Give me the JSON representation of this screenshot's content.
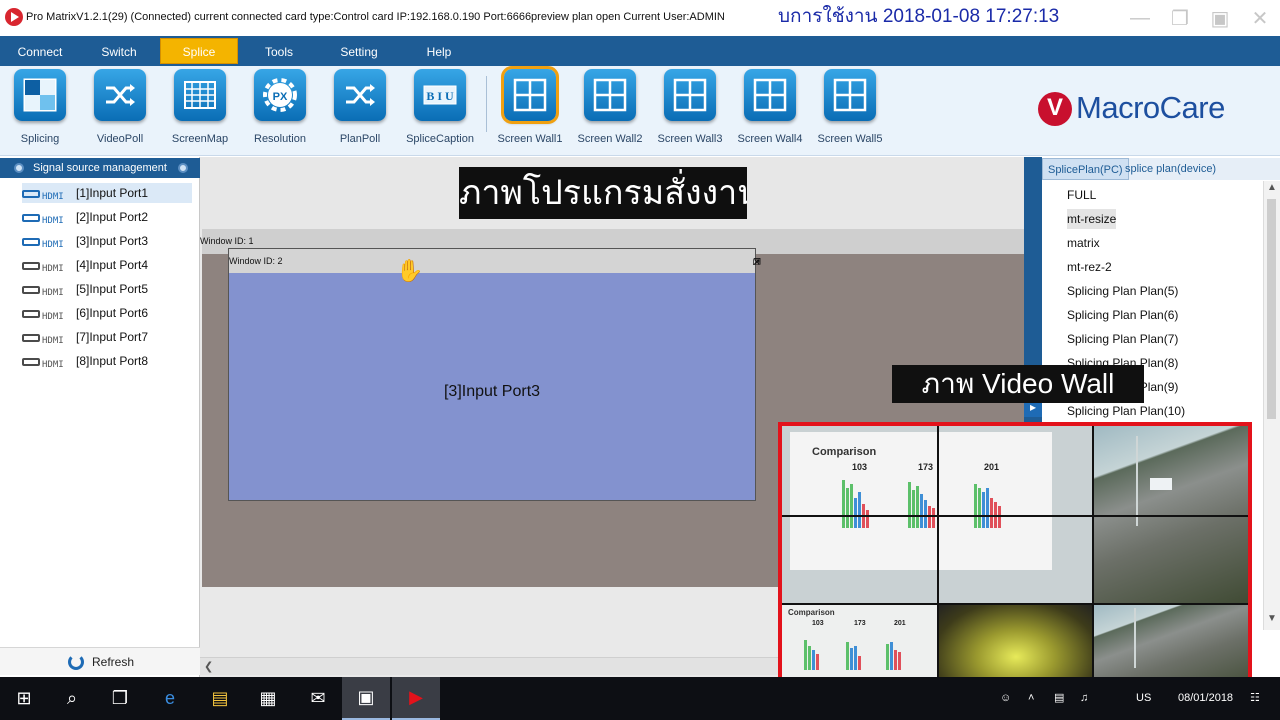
{
  "titlebar": {
    "title": "Pro MatrixV1.2.1(29) (Connected)  current connected card type:Control card    IP:192.168.0.190   Port:6666preview plan open   Current User:ADMIN",
    "overlay_datetime": "บการใช้งาน   2018-01-08 17:27:13"
  },
  "menu": {
    "items": [
      "Connect",
      "Switch",
      "Splice",
      "Tools",
      "Setting",
      "Help"
    ],
    "active": "Splice"
  },
  "toolbar": {
    "tools": [
      {
        "label": "Splicing",
        "icon": "splicing-icon"
      },
      {
        "label": "VideoPoll",
        "icon": "shuffle-icon"
      },
      {
        "label": "ScreenMap",
        "icon": "grid-icon"
      },
      {
        "label": "Resolution",
        "icon": "gear-px-icon"
      },
      {
        "label": "PlanPoll",
        "icon": "shuffle-icon"
      },
      {
        "label": "SpliceCaption",
        "icon": "text-biu-icon"
      },
      {
        "label": "Screen Wall1",
        "icon": "window-grid-icon"
      },
      {
        "label": "Screen Wall2",
        "icon": "window-grid-icon"
      },
      {
        "label": "Screen Wall3",
        "icon": "window-grid-icon"
      },
      {
        "label": "Screen Wall4",
        "icon": "window-grid-icon"
      },
      {
        "label": "Screen Wall5",
        "icon": "window-grid-icon"
      }
    ],
    "selected": "Screen Wall1",
    "brand": "MacroCare"
  },
  "left_panel": {
    "header": "Signal source management",
    "hdmi_tag": "HDMI",
    "sources": [
      {
        "label": "[1]Input Port1",
        "connected": true
      },
      {
        "label": "[2]Input Port2",
        "connected": true
      },
      {
        "label": "[3]Input Port3",
        "connected": true
      },
      {
        "label": "[4]Input Port4",
        "connected": false
      },
      {
        "label": "[5]Input Port5",
        "connected": false
      },
      {
        "label": "[6]Input Port6",
        "connected": false
      },
      {
        "label": "[7]Input Port7",
        "connected": false
      },
      {
        "label": "[8]Input Port8",
        "connected": false
      }
    ],
    "selected_index": 0,
    "refresh_label": "Refresh"
  },
  "canvas": {
    "wall_label": "Window ID: 1",
    "window2_label": "Window ID: 2",
    "window2_source": "[3]Input Port3"
  },
  "captions": {
    "program": "ภาพโปรแกรมสั่งงาน",
    "video_wall": "ภาพ Video Wall"
  },
  "right_panel": {
    "tabs": [
      "SplicePlan(PC)",
      "splice plan(device)"
    ],
    "active_tab": "SplicePlan(PC)",
    "plans": [
      "FULL",
      "mt-resize",
      "matrix",
      "mt-rez-2",
      "Splicing Plan Plan(5)",
      "Splicing Plan Plan(6)",
      "Splicing Plan Plan(7)",
      "Splicing Plan Plan(8)",
      "Splicing Plan Plan(9)",
      "Splicing Plan Plan(10)"
    ],
    "selected": "mt-resize"
  },
  "video_wall_photo": {
    "slide_title": "Comparison",
    "slide_numbers": [
      "103",
      "173",
      "201"
    ]
  },
  "taskbar": {
    "lang": "US",
    "date": "08/01/2018"
  },
  "colors": {
    "menu_bg": "#1e5c95",
    "menu_active": "#f4b400",
    "window_body": "#8392cf",
    "photo_border": "#e3121b",
    "brand": "#1d4f9f"
  }
}
